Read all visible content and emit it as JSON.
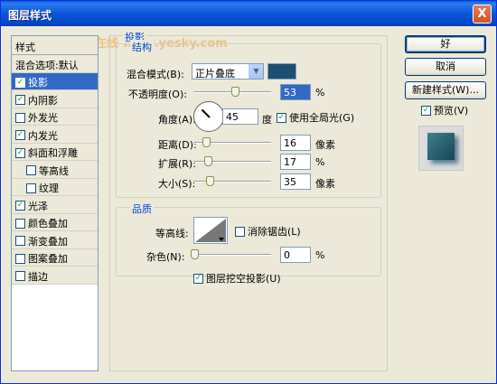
{
  "window": {
    "title": "图层样式",
    "close_glyph": "X"
  },
  "watermark": "天极设计在线 www.yesky.com",
  "styles_list": {
    "header": "样式",
    "blend": "混合选项:默认",
    "items": [
      {
        "label": "投影",
        "checked": true,
        "selected": true,
        "indent": false
      },
      {
        "label": "内阴影",
        "checked": true,
        "selected": false,
        "indent": false
      },
      {
        "label": "外发光",
        "checked": false,
        "selected": false,
        "indent": false
      },
      {
        "label": "内发光",
        "checked": true,
        "selected": false,
        "indent": false
      },
      {
        "label": "斜面和浮雕",
        "checked": true,
        "selected": false,
        "indent": false
      },
      {
        "label": "等高线",
        "checked": false,
        "selected": false,
        "indent": true
      },
      {
        "label": "纹理",
        "checked": false,
        "selected": false,
        "indent": true
      },
      {
        "label": "光泽",
        "checked": true,
        "selected": false,
        "indent": false
      },
      {
        "label": "颜色叠加",
        "checked": false,
        "selected": false,
        "indent": false
      },
      {
        "label": "渐变叠加",
        "checked": false,
        "selected": false,
        "indent": false
      },
      {
        "label": "图案叠加",
        "checked": false,
        "selected": false,
        "indent": false
      },
      {
        "label": "描边",
        "checked": false,
        "selected": false,
        "indent": false
      }
    ]
  },
  "drop_shadow": {
    "group_title": "投影",
    "structure_title": "结构",
    "blend_mode_label": "混合模式(B):",
    "blend_mode_value": "正片叠底",
    "shadow_color": "#1c4f70",
    "opacity_label": "不透明度(O):",
    "opacity_value": "53",
    "opacity_unit": "%",
    "angle_label": "角度(A):",
    "angle_value": "45",
    "angle_unit": "度",
    "global_light_label": "使用全局光(G)",
    "global_light_checked": true,
    "distance_label": "距离(D):",
    "distance_value": "16",
    "distance_unit": "像素",
    "spread_label": "扩展(R):",
    "spread_value": "17",
    "spread_unit": "%",
    "size_label": "大小(S):",
    "size_value": "35",
    "size_unit": "像素",
    "quality_title": "品质",
    "contour_label": "等高线:",
    "antialias_label": "消除锯齿(L)",
    "antialias_checked": false,
    "noise_label": "杂色(N):",
    "noise_value": "0",
    "noise_unit": "%",
    "knockout_label": "图层挖空投影(U)",
    "knockout_checked": true
  },
  "buttons": {
    "ok": "好",
    "cancel": "取消",
    "new_style": "新建样式(W)...",
    "preview_label": "预览(V)",
    "preview_checked": true
  },
  "check_glyph": "✓"
}
